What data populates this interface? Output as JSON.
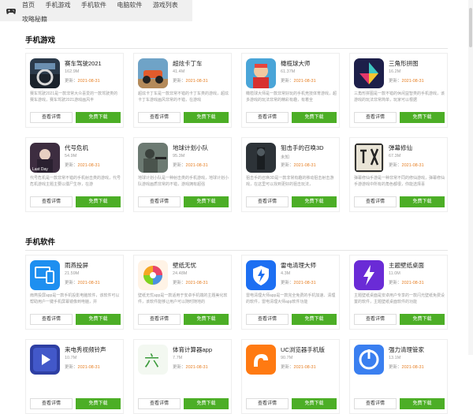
{
  "nav": {
    "items": [
      "首页",
      "手机游戏",
      "手机软件",
      "电脑软件",
      "游戏列表",
      "攻略秘籍"
    ]
  },
  "games": {
    "title": "手机游戏",
    "cards": [
      {
        "name": "赛车驾驶2021",
        "size": "162.9M",
        "update_label": "更新：",
        "date": "2021-08-31",
        "desc": "赛车驾驶2021是一款非常大众喜爱的一款驾驶类的赛车游戏，赛车驾驶2021游戏画风丰",
        "detail": "查看详情",
        "download": "免费下载",
        "icon": "car-driving-icon"
      },
      {
        "name": "超炫卡丁车",
        "size": "41.4M",
        "update_label": "更新：",
        "date": "2021-08-31",
        "desc": "超炫卡丁车是一款非常不错的卡丁车类的游戏，超炫卡丁车游戏画风非常的不错，在游戏",
        "detail": "查看详情",
        "download": "免费下载",
        "icon": "kart-icon"
      },
      {
        "name": "橄榄球大师",
        "size": "61.37M",
        "update_label": "更新：",
        "date": "2021-08-31",
        "desc": "橄榄球大师是一款非常好玩的手机竞技体育游戏，超多游戏的玩法非常的精彩有趣，有着全",
        "detail": "查看详情",
        "download": "免费下载",
        "icon": "football-icon"
      },
      {
        "name": "三角形拼图",
        "size": "16.2M",
        "update_label": "更新：",
        "date": "2021-08-31",
        "desc": "三角形拼图是一款不错的休闲益智类的手机游戏，该游戏的玩法非常简单，玩家可以根据",
        "detail": "查看详情",
        "download": "免费下载",
        "icon": "triangle-puzzle-icon"
      },
      {
        "name": "代号危机",
        "size": "54.9M",
        "update_label": "更新：",
        "date": "2021-08-31",
        "desc": "代号危机是一款非常不错的手机射击类的游戏，代号危机游戏主题主要以僵尸生存，在游",
        "detail": "查看详情",
        "download": "免费下载",
        "icon": "crisis-icon"
      },
      {
        "name": "地球计划小队",
        "size": "95.3M",
        "update_label": "更新：",
        "date": "2021-08-31",
        "desc": "地球计划小队是一种射击类的手机游戏，地球计划小队游戏画质非常的不错，游戏拥有超强",
        "detail": "查看详情",
        "download": "免费下载",
        "icon": "squad-icon"
      },
      {
        "name": "狙击手的召唤3D",
        "size": "未知",
        "update_label": "更新：",
        "date": "2021-08-31",
        "desc": "狙击手的召唤3D是一款非常有趣的移动狙击射击游戏，在这里可以找到更好的狙击玩法，",
        "detail": "查看详情",
        "download": "免费下载",
        "icon": "sniper-icon"
      },
      {
        "name": "弹幕修仙",
        "size": "67.3M",
        "update_label": "更新：",
        "date": "2021-08-31",
        "desc": "弹幕修仙手游是一种非常不同的修仙游戏，弹幕修仙手游游戏中所有的角色都很，你能选择喜",
        "detail": "查看详情",
        "download": "免费下载",
        "icon": "cultivation-icon"
      }
    ]
  },
  "apps": {
    "title": "手机软件",
    "cards": [
      {
        "name": "雨燕投屏",
        "size": "21.59M",
        "update_label": "更新：",
        "date": "2021-08-31",
        "desc": "雨燕投屏app是一款手机投影电脑软件，该软件可以帮助用户一键手机屏幕镜像到电脑，并",
        "detail": "查看详情",
        "download": "免费下载",
        "icon": "screen-cast-icon"
      },
      {
        "name": "壁纸无忧",
        "size": "24.48M",
        "update_label": "更新：",
        "date": "2021-08-31",
        "desc": "壁纸无忧app是一款适用于安卓手机端的主题美化软件，该软件能够让用户可以随时随地的",
        "detail": "查看详情",
        "download": "免费下载",
        "icon": "wallpaper-icon"
      },
      {
        "name": "雷电清理大师",
        "size": "4.3M",
        "update_label": "更新：",
        "date": "2021-08-31",
        "desc": "雷电清理大师app是一款完全免费的手机加速、清理的软件，雷电清理大师app软件功能",
        "detail": "查看详情",
        "download": "免费下载",
        "icon": "cleaner-shield-icon"
      },
      {
        "name": "主题壁纸桌面",
        "size": "11.0M",
        "update_label": "更新：",
        "date": "2021-08-31",
        "desc": "主题壁纸桌面是安卓用户专享的一款闪光壁纸免费设置的软件，主题壁纸桌面软件的功能",
        "detail": "查看详情",
        "download": "免费下载",
        "icon": "theme-lightning-icon"
      },
      {
        "name": "来电秀视频铃声",
        "size": "10.7M",
        "update_label": "更新：",
        "date": "2021-08-31",
        "desc": "",
        "detail": "查看详情",
        "download": "免费下载",
        "icon": "ringtone-icon"
      },
      {
        "name": "体育计算器app",
        "size": "7.7M",
        "update_label": "更新：",
        "date": "2021-08-31",
        "desc": "",
        "detail": "查看详情",
        "download": "免费下载",
        "icon": "calculator-icon"
      },
      {
        "name": "UC浏览器手机版",
        "size": "90.7M",
        "update_label": "更新：",
        "date": "2021-08-31",
        "desc": "",
        "detail": "查看详情",
        "download": "免费下载",
        "icon": "uc-browser-icon"
      },
      {
        "name": "强力清理管家",
        "size": "13.1M",
        "update_label": "更新：",
        "date": "2021-08-31",
        "desc": "",
        "detail": "查看详情",
        "download": "免费下载",
        "icon": "power-clean-icon"
      }
    ]
  },
  "colors": {
    "download": "#4cae26",
    "date": "#e67e22"
  }
}
